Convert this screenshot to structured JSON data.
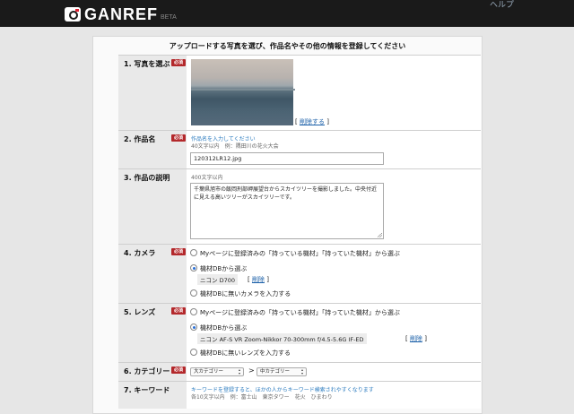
{
  "header": {
    "logo_text": "GANREF",
    "logo_beta": "BETA",
    "help_label": "ヘルプ"
  },
  "form": {
    "heading": "アップロードする写真を選び、作品名やその他の情報を登録してください",
    "required_badge": "必須",
    "photo": {
      "label": "1. 写真を選ぶ",
      "delete_open": "[ ",
      "delete_link": "削除する",
      "delete_close": " ]"
    },
    "title": {
      "label": "2. 作品名",
      "hint": "作品名を入力してください",
      "limit": "40文字以内　例：隅田川の花火大会",
      "value": "120312LR12.jpg"
    },
    "description": {
      "label": "3. 作品の説明",
      "limit": "400文字以内",
      "value": "千葉県旭市の飯岡刑部岬展望台からスカイツリーを撮影しました。中央付近に見える高いツリーがスカイツリーです。"
    },
    "camera": {
      "label": "4. カメラ",
      "opt_mypage": "Myページに登録済みの「持っている機材」「持っていた機材」から選ぶ",
      "opt_db": "機材DBから選ぶ",
      "selected": "ニコン D700",
      "delete_link": "削除",
      "opt_manual": "機材DBに無いカメラを入力する"
    },
    "lens": {
      "label": "5. レンズ",
      "opt_mypage": "Myページに登録済みの「持っている機材」「持っていた機材」から選ぶ",
      "opt_db": "機材DBから選ぶ",
      "selected": "ニコン AF-S VR Zoom-Nikkor 70-300mm f/4.5-5.6G IF-ED",
      "delete_link": "削除",
      "opt_manual": "機材DBに無いレンズを入力する"
    },
    "category": {
      "label": "6. カテゴリー",
      "major_value": "大カテゴリー",
      "arrow": ">",
      "minor_value": "中カテゴリー"
    },
    "keyword": {
      "label": "7. キーワード",
      "hint": "キーワードを登録すると、ほかの人からキーワード検索されやすくなります",
      "example": "各10文字以内　例：富士山　東京タワー　花火　ひまわり"
    }
  },
  "colors": {
    "required": "#b3282b",
    "link": "#1a5fa8",
    "topbar": "#1a1a1a"
  }
}
